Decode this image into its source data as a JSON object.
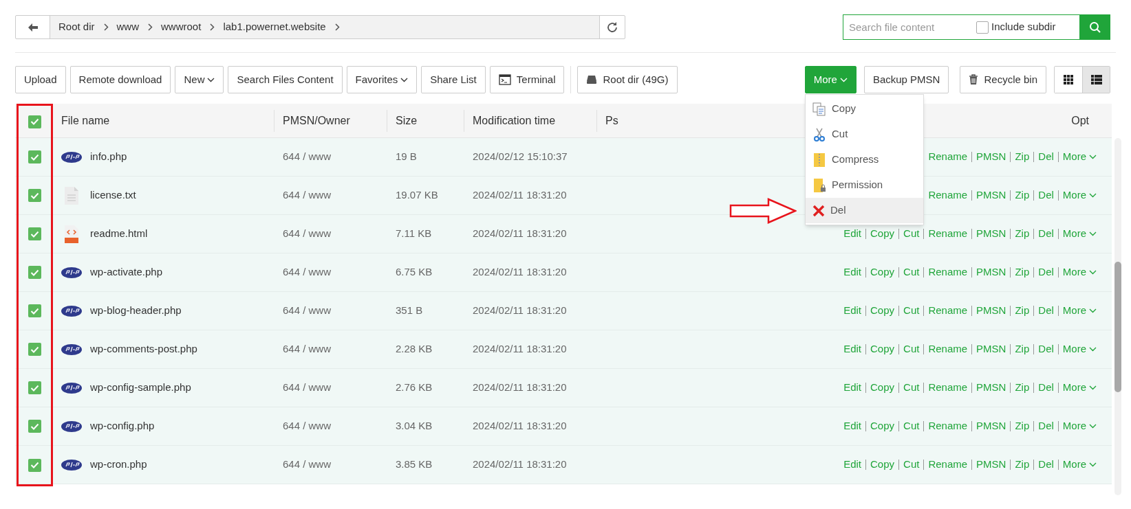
{
  "breadcrumb": [
    "Root dir",
    "www",
    "wwwroot",
    "lab1.powernet.website"
  ],
  "search": {
    "placeholder": "Search file content",
    "include_subdir": {
      "label": "Include subdir",
      "checked": false
    }
  },
  "toolbar": [
    {
      "label": "Upload",
      "kind": "plain"
    },
    {
      "label": "Remote download",
      "kind": "plain"
    },
    {
      "label": "New",
      "kind": "caret"
    },
    {
      "label": "Search Files Content",
      "kind": "plain"
    },
    {
      "label": "Favorites",
      "kind": "caret"
    },
    {
      "label": "Share List",
      "kind": "plain"
    },
    {
      "label": "Terminal",
      "kind": "terminal"
    },
    {
      "label": "Root dir (49G)",
      "kind": "disk"
    }
  ],
  "toolbar_right": [
    {
      "label": "More",
      "kind": "primary"
    },
    {
      "label": "Backup PMSN",
      "kind": "plain"
    },
    {
      "label": "Recycle bin",
      "kind": "trash"
    }
  ],
  "view_modes": [
    {
      "kind": "grid",
      "selected": false
    },
    {
      "kind": "list",
      "selected": true
    }
  ],
  "more_menu": {
    "items": [
      {
        "label": "Copy",
        "kind": "copy",
        "selected": false
      },
      {
        "label": "Cut",
        "kind": "cut",
        "selected": false
      },
      {
        "label": "Compress",
        "kind": "compress",
        "selected": false
      },
      {
        "label": "Permission",
        "kind": "permission",
        "selected": false
      },
      {
        "label": "Del",
        "kind": "delete",
        "selected": true
      }
    ]
  },
  "table": {
    "select_all": {
      "checked": true
    },
    "columns": [
      "File name",
      "PMSN/Owner",
      "Size",
      "Modification time",
      "Ps",
      "Opt"
    ],
    "rows": [
      {
        "checked": true,
        "kind": "php",
        "name": "info.php",
        "owner": "644 / www",
        "size": "19 B",
        "modified": "2024/02/12 15:10:37",
        "actions": [
          "Rename",
          "PMSN",
          "Zip",
          "Del",
          "More"
        ]
      },
      {
        "checked": true,
        "kind": "text",
        "name": "license.txt",
        "owner": "644 / www",
        "size": "19.07 KB",
        "modified": "2024/02/11 18:31:20",
        "actions": [
          "Rename",
          "PMSN",
          "Zip",
          "Del",
          "More"
        ]
      },
      {
        "checked": true,
        "kind": "html",
        "name": "readme.html",
        "owner": "644 / www",
        "size": "7.11 KB",
        "modified": "2024/02/11 18:31:20",
        "actions": [
          "Edit",
          "Copy",
          "Cut",
          "Rename",
          "PMSN",
          "Zip",
          "Del",
          "More"
        ]
      },
      {
        "checked": true,
        "kind": "php",
        "name": "wp-activate.php",
        "owner": "644 / www",
        "size": "6.75 KB",
        "modified": "2024/02/11 18:31:20",
        "actions": [
          "Edit",
          "Copy",
          "Cut",
          "Rename",
          "PMSN",
          "Zip",
          "Del",
          "More"
        ]
      },
      {
        "checked": true,
        "kind": "php",
        "name": "wp-blog-header.php",
        "owner": "644 / www",
        "size": "351 B",
        "modified": "2024/02/11 18:31:20",
        "actions": [
          "Edit",
          "Copy",
          "Cut",
          "Rename",
          "PMSN",
          "Zip",
          "Del",
          "More"
        ]
      },
      {
        "checked": true,
        "kind": "php",
        "name": "wp-comments-post.php",
        "owner": "644 / www",
        "size": "2.28 KB",
        "modified": "2024/02/11 18:31:20",
        "actions": [
          "Edit",
          "Copy",
          "Cut",
          "Rename",
          "PMSN",
          "Zip",
          "Del",
          "More"
        ]
      },
      {
        "checked": true,
        "kind": "php",
        "name": "wp-config-sample.php",
        "owner": "644 / www",
        "size": "2.76 KB",
        "modified": "2024/02/11 18:31:20",
        "actions": [
          "Edit",
          "Copy",
          "Cut",
          "Rename",
          "PMSN",
          "Zip",
          "Del",
          "More"
        ]
      },
      {
        "checked": true,
        "kind": "php",
        "name": "wp-config.php",
        "owner": "644 / www",
        "size": "3.04 KB",
        "modified": "2024/02/11 18:31:20",
        "actions": [
          "Edit",
          "Copy",
          "Cut",
          "Rename",
          "PMSN",
          "Zip",
          "Del",
          "More"
        ]
      },
      {
        "checked": true,
        "kind": "php",
        "name": "wp-cron.php",
        "owner": "644 / www",
        "size": "3.85 KB",
        "modified": "2024/02/11 18:31:20",
        "actions": [
          "Edit",
          "Copy",
          "Cut",
          "Rename",
          "PMSN",
          "Zip",
          "Del",
          "More"
        ]
      }
    ]
  }
}
